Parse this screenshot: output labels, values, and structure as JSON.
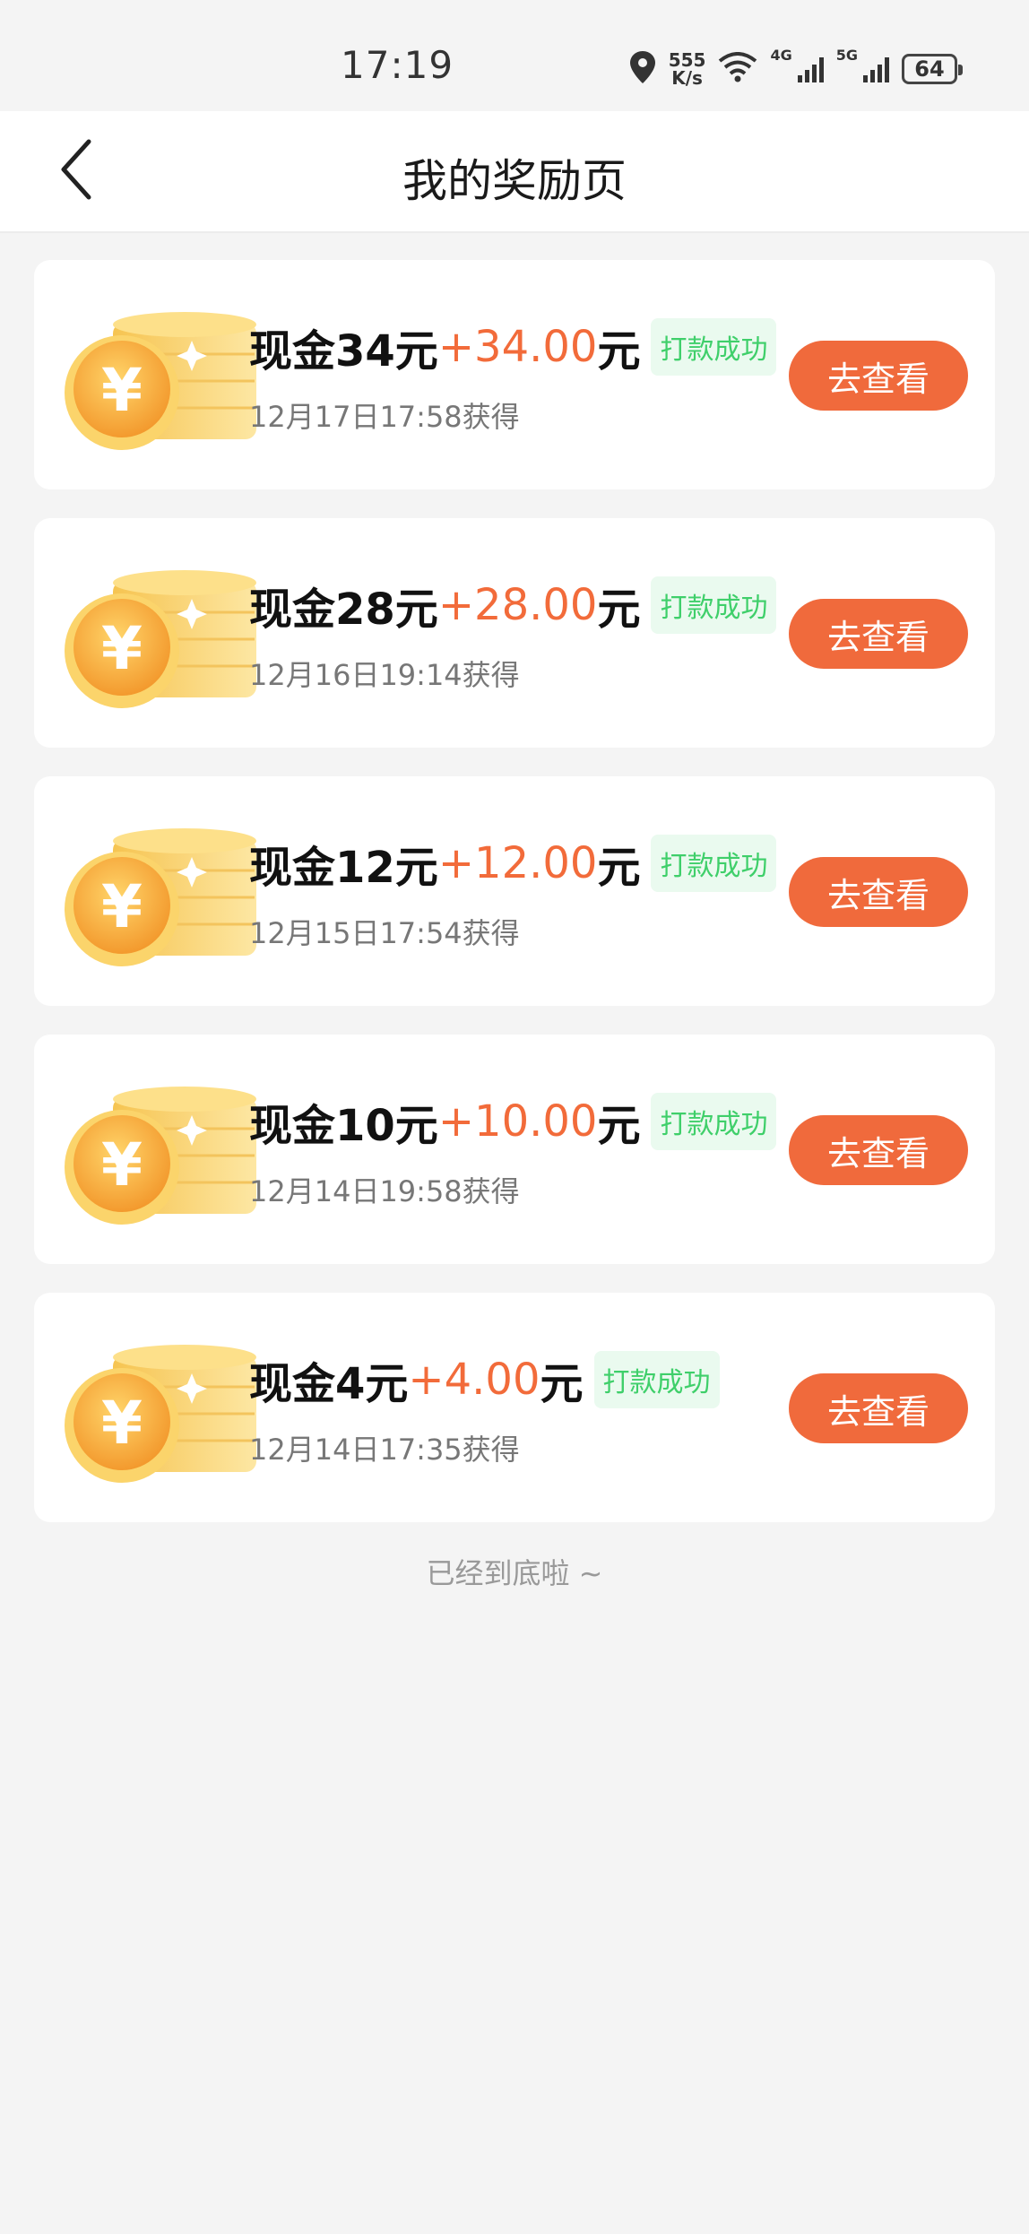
{
  "status": {
    "time": "17:19",
    "speed_value": "555",
    "speed_unit": "K/s",
    "net1": "4G",
    "net2": "5G",
    "battery": "64"
  },
  "nav": {
    "title": "我的奖励页"
  },
  "rewards": [
    {
      "title": "现金34元",
      "amount": "+34.00",
      "unit": "元",
      "badge": "打款成功",
      "time": "12月17日17:58获得",
      "button": "去查看"
    },
    {
      "title": "现金28元",
      "amount": "+28.00",
      "unit": "元",
      "badge": "打款成功",
      "time": "12月16日19:14获得",
      "button": "去查看"
    },
    {
      "title": "现金12元",
      "amount": "+12.00",
      "unit": "元",
      "badge": "打款成功",
      "time": "12月15日17:54获得",
      "button": "去查看"
    },
    {
      "title": "现金10元",
      "amount": "+10.00",
      "unit": "元",
      "badge": "打款成功",
      "time": "12月14日19:58获得",
      "button": "去查看"
    },
    {
      "title": "现金4元",
      "amount": "+4.00",
      "unit": "元",
      "badge": "打款成功",
      "time": "12月14日17:35获得",
      "button": "去查看"
    }
  ],
  "footer": {
    "end_text": "已经到底啦 ~"
  },
  "colors": {
    "accent": "#f06a3c",
    "amount": "#f26b3a",
    "badge_text": "#3fcf6a",
    "badge_bg": "#eafaef"
  }
}
